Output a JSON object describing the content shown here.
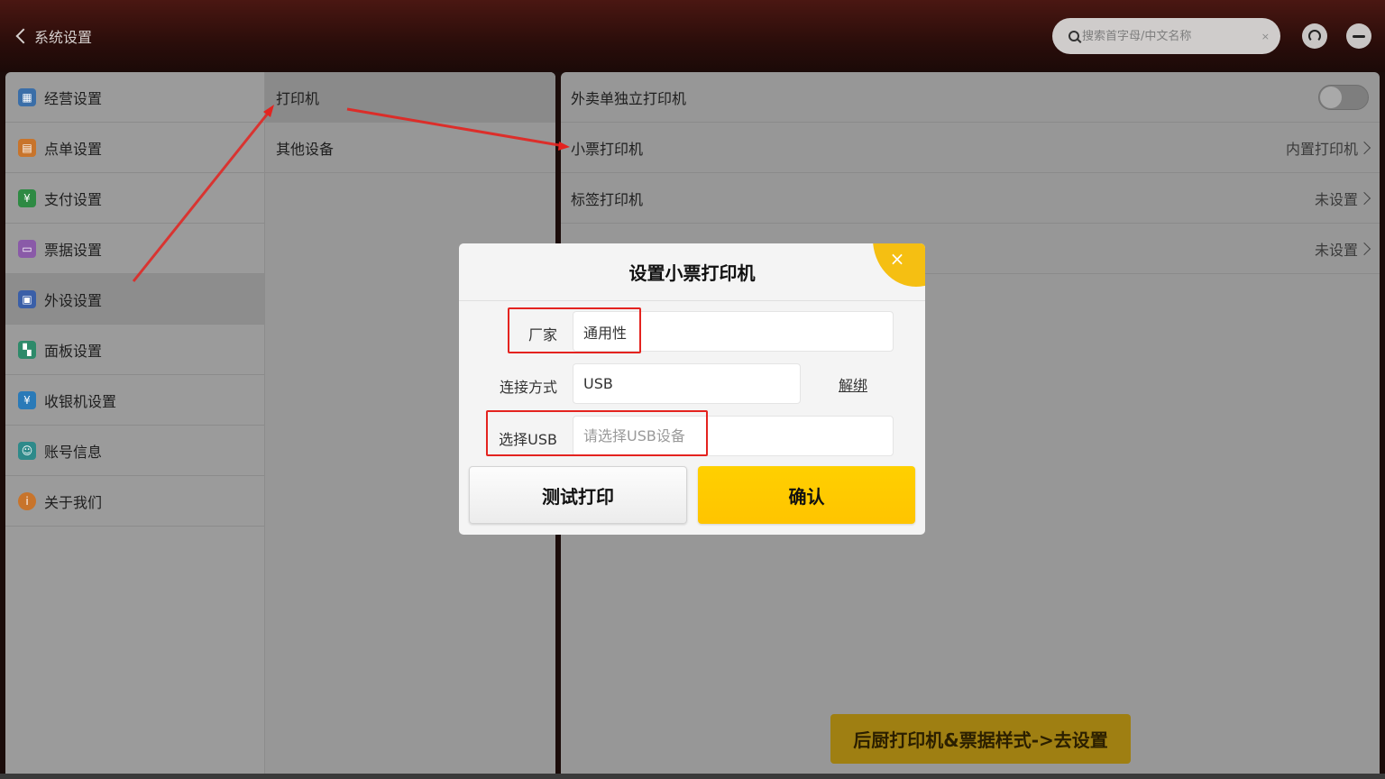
{
  "header": {
    "back_label": "系统设置",
    "search_placeholder": "搜索首字母/中文名称",
    "clear_symbol": "×"
  },
  "sidebar": {
    "items": [
      {
        "label": "经营设置",
        "icon": "store-icon",
        "color": "#3a6ea8"
      },
      {
        "label": "点单设置",
        "icon": "order-icon",
        "color": "#c8742b"
      },
      {
        "label": "支付设置",
        "icon": "yuan-icon",
        "color": "#2e8a43"
      },
      {
        "label": "票据设置",
        "icon": "receipt-icon",
        "color": "#8a5aa8"
      },
      {
        "label": "外设设置",
        "icon": "peripheral-icon",
        "color": "#3a5fa8"
      },
      {
        "label": "面板设置",
        "icon": "panel-icon",
        "color": "#2e8a6a"
      },
      {
        "label": "收银机设置",
        "icon": "cashier-icon",
        "color": "#2a7ab8"
      },
      {
        "label": "账号信息",
        "icon": "account-icon",
        "color": "#2e8a8a"
      },
      {
        "label": "关于我们",
        "icon": "info-icon",
        "color": "#c8742b"
      }
    ]
  },
  "subnav": {
    "items": [
      {
        "label": "打印机"
      },
      {
        "label": "其他设备"
      }
    ]
  },
  "settings": {
    "rows": [
      {
        "label": "外卖单独立打印机",
        "value": ""
      },
      {
        "label": "小票打印机",
        "value": "内置打印机"
      },
      {
        "label": "标签打印机",
        "value": "未设置"
      },
      {
        "label": "",
        "value": "未设置"
      }
    ]
  },
  "bottom_button": "后厨打印机&票据样式->去设置",
  "dialog": {
    "title": "设置小票打印机",
    "close_symbol": "×",
    "vendor_label": "厂家",
    "vendor_value": "通用性",
    "connection_label": "连接方式",
    "connection_value": "USB",
    "unbind_label": "解绑",
    "usb_label": "选择USB",
    "usb_placeholder": "请选择USB设备",
    "test_button": "测试打印",
    "confirm_button": "确认"
  },
  "colors": {
    "accent": "#ffc800",
    "annotation": "#e4231f"
  }
}
